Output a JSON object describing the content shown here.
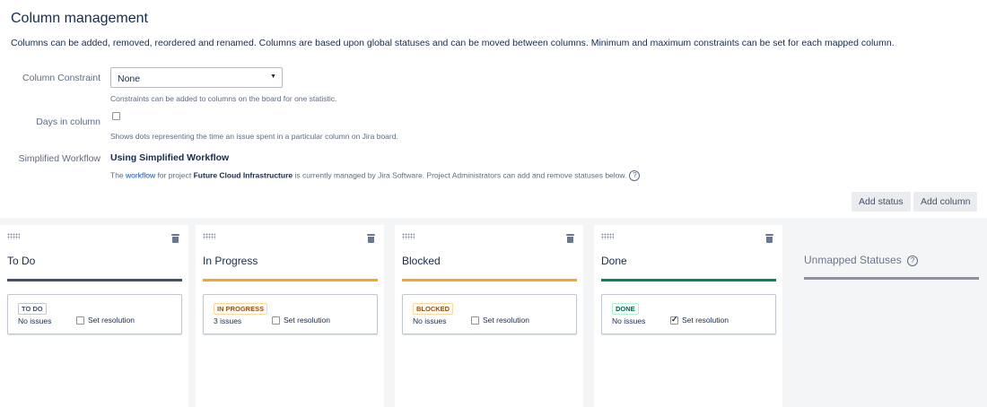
{
  "page": {
    "title": "Column management",
    "description": "Columns can be added, removed, reordered and renamed. Columns are based upon global statuses and can be moved between columns. Minimum and maximum constraints can be set for each mapped column."
  },
  "constraint": {
    "label": "Column Constraint",
    "value": "None",
    "help": "Constraints can be added to columns on the board for one statistic."
  },
  "days": {
    "label": "Days in column",
    "checked": false,
    "help": "Shows dots representing the time an issue spent in a particular column on Jira board."
  },
  "workflow": {
    "label": "Simplified Workflow",
    "title": "Using Simplified Workflow",
    "note_pre": "The ",
    "note_link": "workflow",
    "note_mid": " for project ",
    "project": "Future Cloud Infrastructure",
    "note_post": " is currently managed by Jira Software. Project Administrators can add and remove statuses below.",
    "help_icon": "question-circle-icon"
  },
  "buttons": {
    "add_status": "Add status",
    "add_column": "Add column"
  },
  "columns": [
    {
      "name": "To Do",
      "bar_color": "#42526e",
      "status": "TO DO",
      "status_color": "#42526e",
      "status_border": "#c1c7d0",
      "issues": "No issues",
      "resolution_label": "Set resolution",
      "resolution_checked": false
    },
    {
      "name": "In Progress",
      "bar_color": "#f6a623",
      "status": "IN PROGRESS",
      "status_color": "#974f0c",
      "status_border": "#ffd79b",
      "issues": "3 issues",
      "resolution_label": "Set resolution",
      "resolution_checked": false
    },
    {
      "name": "Blocked",
      "bar_color": "#f6a623",
      "status": "BLOCKED",
      "status_color": "#974f0c",
      "status_border": "#ffd79b",
      "issues": "No issues",
      "resolution_label": "Set resolution",
      "resolution_checked": false
    },
    {
      "name": "Done",
      "bar_color": "#00875a",
      "status": "DONE",
      "status_color": "#006644",
      "status_border": "#abf5d1",
      "issues": "No issues",
      "resolution_label": "Set resolution",
      "resolution_checked": true
    }
  ],
  "unmapped": {
    "title": "Unmapped Statuses",
    "bar_color": "#8993a4"
  }
}
